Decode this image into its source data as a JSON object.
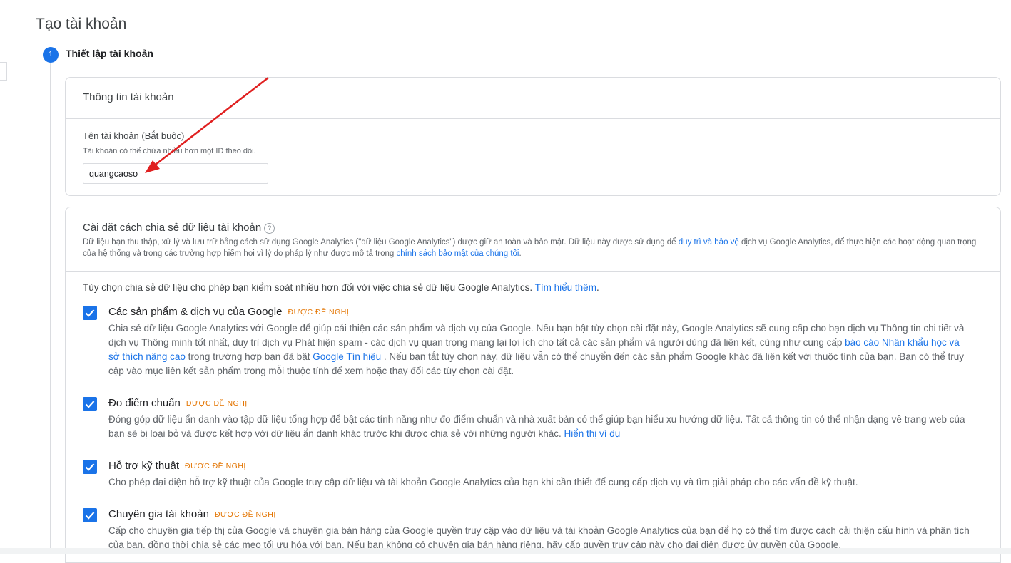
{
  "page": {
    "title": "Tạo tài khoản"
  },
  "step": {
    "number": "1",
    "label": "Thiết lập tài khoản"
  },
  "account_info": {
    "title": "Thông tin tài khoản",
    "name_label": "Tên tài khoản (Bắt buộc)",
    "name_help": "Tài khoản có thể chứa nhiều hơn một ID theo dõi.",
    "name_value": "quangcaoso"
  },
  "sharing": {
    "title": "Cài đặt cách chia sẻ dữ liệu tài khoản",
    "help_icon": "question-mark-circle-icon",
    "desc_before_link1": "Dữ liệu bạn thu thập, xử lý và lưu trữ bằng cách sử dụng Google Analytics (\"dữ liệu Google Analytics\") được giữ an toàn và bảo mật. Dữ liệu này được sử dụng để ",
    "desc_link1": "duy trì và bảo vệ",
    "desc_mid": " dịch vụ Google Analytics, để thực hiện các hoạt động quan trọng của hệ thống và trong các trường hợp hiếm hoi vì lý do pháp lý như được mô tả trong ",
    "desc_link2": "chính sách bảo mật của chúng tôi",
    "desc_end": ".",
    "intro_text": "Tùy chọn chia sẻ dữ liệu cho phép bạn kiểm soát nhiều hơn đối với việc chia sẻ dữ liệu Google Analytics. ",
    "intro_link": "Tìm hiểu thêm",
    "intro_end": ".",
    "options": [
      {
        "title": "Các sản phẩm & dịch vụ của Google",
        "badge": "ĐƯỢC ĐỀ NGHỊ",
        "desc_1": "Chia sẻ dữ liệu Google Analytics với Google để giúp cải thiện các sản phẩm và dịch vụ của Google. Nếu bạn bật tùy chọn cài đặt này, Google Analytics sẽ cung cấp cho bạn dịch vụ Thông tin chi tiết và dịch vụ Thông minh tốt nhất, duy trì dịch vụ Phát hiện spam - các dịch vụ quan trọng mang lại lợi ích cho tất cả các sản phẩm và người dùng đã liên kết, cũng như cung cấp ",
        "link_1": "báo cáo Nhân khẩu học và sở thích nâng cao",
        "desc_2": " trong trường hợp bạn đã bật ",
        "link_2": "Google Tín hiệu",
        "desc_3": " . Nếu bạn tắt tùy chọn này, dữ liệu vẫn có thể chuyển đến các sản phẩm Google khác đã liên kết với thuộc tính của bạn. Bạn có thể truy cập vào mục liên kết sản phẩm trong mỗi thuộc tính để xem hoặc thay đổi các tùy chọn cài đặt."
      },
      {
        "title": "Đo điểm chuẩn",
        "badge": "ĐƯỢC ĐỀ NGHỊ",
        "desc_1": "Đóng góp dữ liệu ẩn danh vào tập dữ liệu tổng hợp để bật các tính năng như đo điểm chuẩn và nhà xuất bản có thể giúp bạn hiểu xu hướng dữ liệu. Tất cả thông tin có thể nhận dạng về trang web của bạn sẽ bị loại bỏ và được kết hợp với dữ liệu ẩn danh khác trước khi được chia sẻ với những người khác. ",
        "link_1": "Hiển thị ví dụ"
      },
      {
        "title": "Hỗ trợ kỹ thuật",
        "badge": "ĐƯỢC ĐỀ NGHỊ",
        "desc_1": "Cho phép đại diện hỗ trợ kỹ thuật của Google truy cập dữ liệu và tài khoản Google Analytics của bạn khi cần thiết để cung cấp dịch vụ và tìm giải pháp cho các vấn đề kỹ thuật."
      },
      {
        "title": "Chuyên gia tài khoản",
        "badge": "ĐƯỢC ĐỀ NGHỊ",
        "desc_1": "Cấp cho chuyên gia tiếp thị của Google và chuyên gia bán hàng của Google quyền truy cập vào dữ liệu và tài khoản Google Analytics của bạn để họ có thể tìm được cách cải thiện cấu hình và phân tích của bạn, đồng thời chia sẻ các mẹo tối ưu hóa với bạn. Nếu bạn không có chuyên gia bán hàng riêng, hãy cấp quyền truy cập này cho đại diện được ủy quyền của Google."
      }
    ]
  },
  "checkbox_icon": "checkmark-icon",
  "annotation": {
    "arrow_color": "#e02020",
    "accent": "#1a73e8",
    "badge_color": "#e37400"
  }
}
